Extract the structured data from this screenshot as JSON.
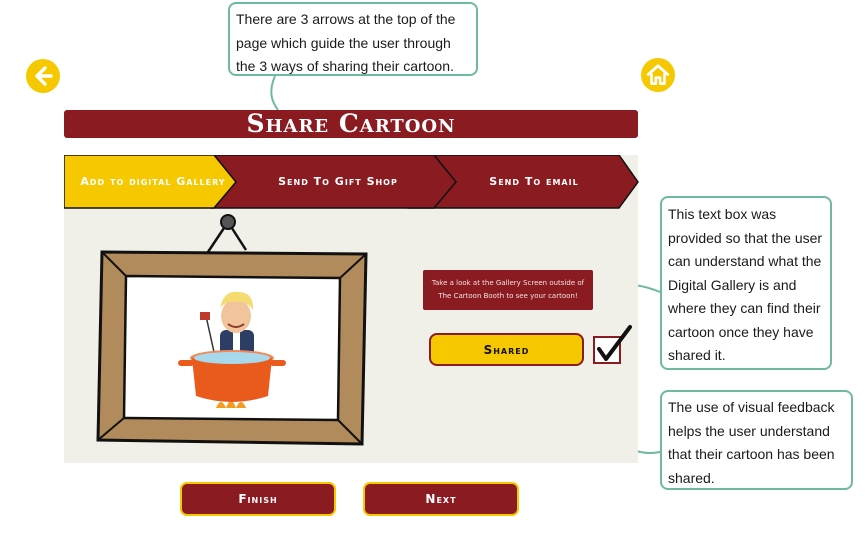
{
  "nav": {
    "back_icon": "arrow-left-icon",
    "home_icon": "home-icon",
    "accent_color": "#f6c800"
  },
  "title": "Share Cartoon",
  "steps": [
    {
      "label": "Add to digital Gallery",
      "active": true
    },
    {
      "label": "Send To Gift Shop",
      "active": false
    },
    {
      "label": "Send To email",
      "active": false
    }
  ],
  "main": {
    "info_message": "Take a look at the Gallery Screen outside of The Cartoon Booth to see your cartoon!",
    "shared_label": "Shared",
    "shared_checked": true
  },
  "footer": {
    "finish_label": "Finish",
    "next_label": "Next"
  },
  "callouts": {
    "arrows": "There are 3 arrows at the top of the page which guide the user through the 3 ways of sharing their cartoon.",
    "textbox": "This text box was provided so that the user can understand what the Digital Gallery is and where they can find their cartoon once they have shared it.",
    "feedback": "The use of visual feedback helps the user understand that their cartoon has been shared."
  },
  "colors": {
    "brand_red": "#8a1b21",
    "yellow": "#f6c800",
    "panel_bg": "#f0efe8",
    "callout_border": "#6fb8a2"
  }
}
